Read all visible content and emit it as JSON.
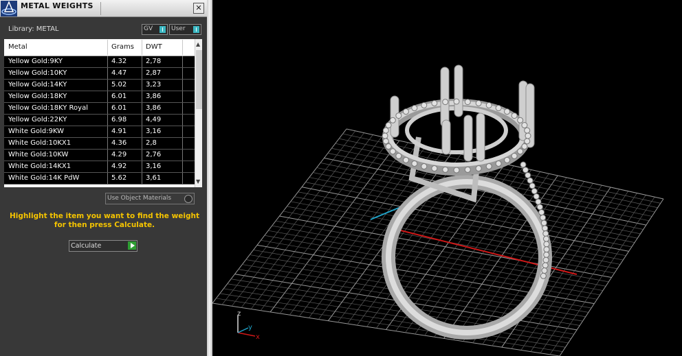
{
  "panel": {
    "title": "METAL WEIGHTS",
    "close_symbol": "✕",
    "library_label": "Library: METAL",
    "gv_label": "GV",
    "user_label": "User",
    "table": {
      "columns": [
        "Metal",
        "Grams",
        "DWT"
      ],
      "rows": [
        {
          "metal": "Yellow Gold:9KY",
          "grams": "4.32",
          "dwt": "2,78"
        },
        {
          "metal": "Yellow Gold:10KY",
          "grams": "4.47",
          "dwt": "2,87"
        },
        {
          "metal": "Yellow Gold:14KY",
          "grams": "5.02",
          "dwt": "3,23"
        },
        {
          "metal": "Yellow Gold:18KY",
          "grams": "6.01",
          "dwt": "3,86"
        },
        {
          "metal": "Yellow Gold:18KY Royal",
          "grams": "6.01",
          "dwt": "3,86"
        },
        {
          "metal": "Yellow Gold:22KY",
          "grams": "6.98",
          "dwt": "4,49"
        },
        {
          "metal": "White Gold:9KW",
          "grams": "4.91",
          "dwt": "3,16"
        },
        {
          "metal": "White Gold:10KX1",
          "grams": "4.36",
          "dwt": "2,8"
        },
        {
          "metal": "White Gold:10KW",
          "grams": "4.29",
          "dwt": "2,76"
        },
        {
          "metal": "White Gold:14KX1",
          "grams": "4.92",
          "dwt": "3,16"
        },
        {
          "metal": "White Gold:14K PdW",
          "grams": "5.62",
          "dwt": "3,61"
        }
      ]
    },
    "use_object_materials": "Use Object Materials",
    "instructions_line1": "Highlight the item you want to find the weight",
    "instructions_line2": "for then press Calculate.",
    "calculate_label": "Calculate"
  },
  "viewport": {
    "axis_labels": {
      "z": "z",
      "y": "y",
      "x": "x"
    },
    "colors": {
      "x_axis": "#d01818",
      "y_axis": "#1fa3c9",
      "grid": "#8a8a8a",
      "ring": "#c8c8c8"
    }
  }
}
